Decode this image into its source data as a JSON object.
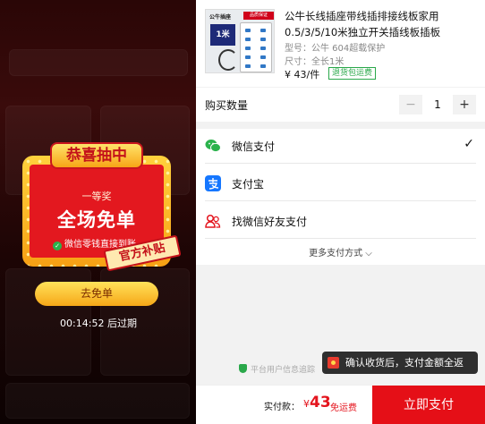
{
  "promo": {
    "congrats": "恭喜抽中",
    "prize_tier": "一等奖",
    "prize_name": "全场免单",
    "prize_note": "微信零钱直接到账",
    "subsidy_tag": "官方补贴",
    "go_button": "去免单",
    "countdown": "00:14:52 后过期"
  },
  "product": {
    "title": "公牛长线插座带线插排接线板家用0.5/3/5/10米独立开关插线板插板",
    "model": "型号：公牛 604超载保护",
    "size": "尺寸：全长1米",
    "price": "¥ 43/件",
    "return_tag": "退货包运费",
    "thumb_brand": "公牛插座",
    "thumb_badge": "品质保证",
    "thumb_length": "1米"
  },
  "quantity": {
    "label": "购买数量",
    "minus": "−",
    "value": "1",
    "plus": "+"
  },
  "payment": {
    "methods": [
      {
        "label": "微信支付",
        "icon": "wechat-pay-icon",
        "selected": true,
        "check": "✓"
      },
      {
        "label": "支付宝",
        "icon": "alipay-icon",
        "selected": false
      },
      {
        "label": "找微信好友支付",
        "icon": "friends-icon",
        "selected": false
      }
    ],
    "more": "更多支付方式"
  },
  "secure_text": "平台用户信息追踪",
  "tooltip": "确认收货后，支付金额全返",
  "checkout": {
    "label": "实付款：",
    "currency": "¥",
    "amount": "43",
    "shipping": "免运费",
    "pay_button": "立即支付"
  },
  "colors": {
    "accent_red": "#e50f17",
    "wechat_green": "#2bb24c",
    "alipay_blue": "#1677ff"
  }
}
